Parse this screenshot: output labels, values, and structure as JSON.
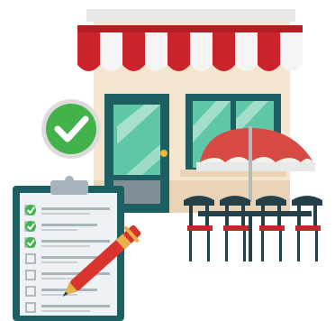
{
  "illustration": {
    "colors": {
      "awning_red": "#c9242b",
      "awning_white": "#f4f4f4",
      "facade": "#f6e5cf",
      "facade_trim": "#e9d4b6",
      "door_frame": "#1b5f63",
      "glass": "#5fc7a8",
      "glass_light": "#b9e6d5",
      "umbrella_red": "#d64a43",
      "furniture": "#24414a",
      "cushion": "#c9242b",
      "check_badge": "#43b24a",
      "clipboard_frame": "#1b5f63",
      "clipboard_paper": "#eef2f4",
      "checkbox_green": "#43b24a",
      "line_grey": "#a9b4bb",
      "pen_red": "#d8332c",
      "pen_gold": "#e8b04a"
    },
    "checklist": {
      "total_items": 7,
      "checked_items": 3
    },
    "table_chairs": 4,
    "awning_stripes": 10,
    "icons": [
      "shop-icon",
      "check-badge-icon",
      "clipboard-icon",
      "pen-icon",
      "umbrella-icon"
    ]
  }
}
